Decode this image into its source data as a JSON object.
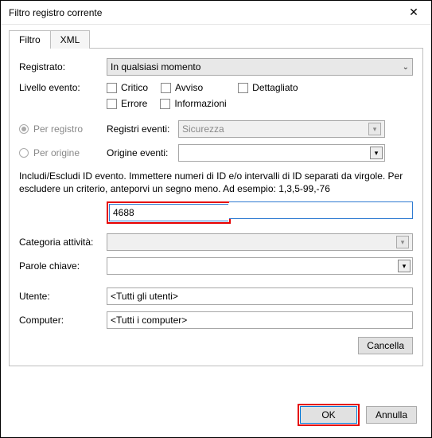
{
  "window": {
    "title": "Filtro registro corrente"
  },
  "tabs": {
    "filter": "Filtro",
    "xml": "XML"
  },
  "labels": {
    "logged": "Registrato:",
    "eventLevel": "Livello evento:",
    "perLog": "Per registro",
    "perSource": "Per origine",
    "eventLogs": "Registri eventi:",
    "eventSources": "Origine eventi:",
    "helpText": "Includi/Escludi ID evento. Immettere numeri di ID e/o intervalli di ID separati da virgole. Per escludere un criterio, anteporvi un segno meno. Ad esempio: 1,3,5-99,-76",
    "taskCategory": "Categoria attività:",
    "keywords": "Parole chiave:",
    "user": "Utente:",
    "computer": "Computer:"
  },
  "fields": {
    "logged": "In qualsiasi momento",
    "levels": {
      "critical": "Critico",
      "warning": "Avviso",
      "verbose": "Dettagliato",
      "error": "Errore",
      "information": "Informazioni"
    },
    "eventLogs": "Sicurezza",
    "eventSources": "",
    "eventId": "4688",
    "taskCategory": "",
    "keywords": "",
    "user": "<Tutti gli utenti>",
    "computer": "<Tutti i computer>"
  },
  "buttons": {
    "clear": "Cancella",
    "ok": "OK",
    "cancel": "Annulla"
  }
}
